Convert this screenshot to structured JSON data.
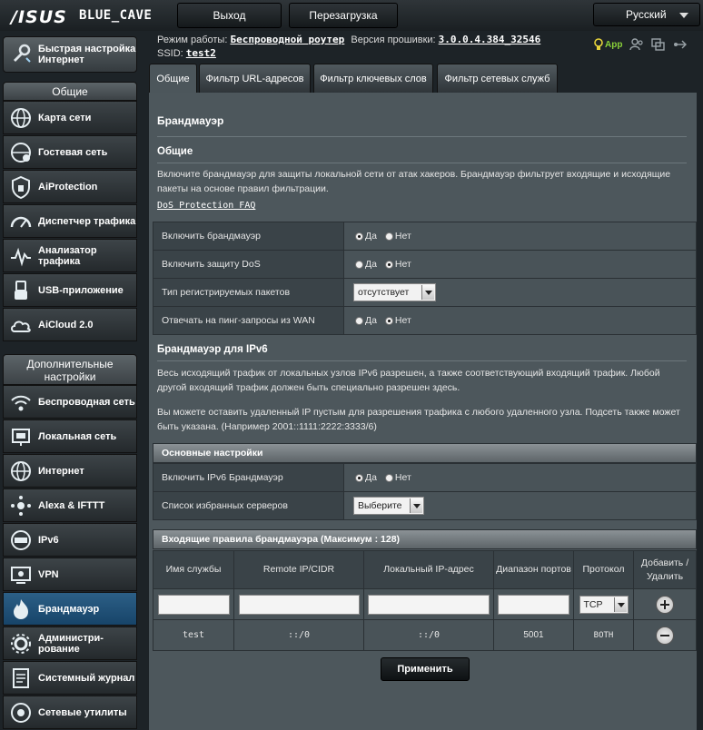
{
  "brand": {
    "logo": "/ISUS",
    "model": "BLUE_CAVE"
  },
  "topbar": {
    "logout": "Выход",
    "reboot": "Перезагрузка",
    "language": "Русский"
  },
  "sidebar": {
    "quick_setup": "Быстрая настройка Интернет",
    "general_header": "Общие",
    "general_items": [
      {
        "label": "Карта сети",
        "icon": "network-map-icon"
      },
      {
        "label": "Гостевая сеть",
        "icon": "guest-network-icon"
      },
      {
        "label": "AiProtection",
        "icon": "aiprotection-icon"
      },
      {
        "label": "Диспетчер трафика",
        "icon": "traffic-manager-icon"
      },
      {
        "label": "Анализатор трафика",
        "icon": "traffic-analyzer-icon"
      },
      {
        "label": "USB-приложение",
        "icon": "usb-icon"
      },
      {
        "label": "AiCloud 2.0",
        "icon": "aicloud-icon"
      }
    ],
    "advanced_header": "Дополнительные настройки",
    "advanced_items": [
      {
        "label": "Беспроводная сеть",
        "icon": "wireless-icon"
      },
      {
        "label": "Локальная сеть",
        "icon": "lan-icon"
      },
      {
        "label": "Интернет",
        "icon": "internet-globe-icon"
      },
      {
        "label": "Alexa & IFTTT",
        "icon": "alexa-icon"
      },
      {
        "label": "IPv6",
        "icon": "ipv6-icon"
      },
      {
        "label": "VPN",
        "icon": "vpn-icon"
      },
      {
        "label": "Брандмауэр",
        "icon": "firewall-icon",
        "active": true
      },
      {
        "label": "Администри-рование",
        "icon": "administration-icon"
      },
      {
        "label": "Системный журнал",
        "icon": "system-log-icon"
      },
      {
        "label": "Сетевые утилиты",
        "icon": "network-tools-icon"
      }
    ]
  },
  "status": {
    "mode_label": "Режим работы:",
    "mode_value": "Беспроводной роутер",
    "firmware_label": "Версия прошивки:",
    "firmware_value": "3.0.0.4.384_32546",
    "ssid_label": "SSID:",
    "ssid_value": "test2",
    "app_label": "App"
  },
  "tabs": [
    "Общие",
    "Фильтр URL-адресов",
    "Фильтр ключевых слов",
    "Фильтр сетевых служб"
  ],
  "page": {
    "title": "Брандмауэр",
    "general_heading": "Общие",
    "general_desc": "Включите брандмауэр для защиты локальной сети от атак хакеров. Брандмауэр фильтрует входящие и исходящие пакеты на основе правил фильтрации.",
    "dos_link": "DoS Protection FAQ",
    "rows": [
      {
        "label": "Включить брандмауэр",
        "yes": "Да",
        "no": "Нет",
        "selected": "yes"
      },
      {
        "label": "Включить защиту DoS",
        "yes": "Да",
        "no": "Нет",
        "selected": "no"
      },
      {
        "label": "Тип регистрируемых пакетов",
        "select": "отсутствует"
      },
      {
        "label": "Отвечать на пинг-запросы из WAN",
        "yes": "Да",
        "no": "Нет",
        "selected": "no"
      }
    ],
    "ipv6_heading": "Брандмауэр для IPv6",
    "ipv6_desc1": "Весь исходящий трафик от локальных узлов IPv6 разрешен, а также соответствующий входящий трафик. Любой другой входящий трафик должен быть специально разрешен здесь.",
    "ipv6_desc2": "Вы можете оставить удаленный IP пустым для разрешения трафика с любого удаленного узла. Подсеть также может быть указана. (Например 2001::1111:2222:3333/6)",
    "basic_header": "Основные настройки",
    "ipv6_rows": [
      {
        "label": "Включить IPv6 Брандмауэр",
        "yes": "Да",
        "no": "Нет",
        "selected": "yes"
      },
      {
        "label": "Список избранных серверов",
        "select": "Выберите"
      }
    ],
    "rules_header": "Входящие правила брандмауэра (Максимум : 128)",
    "rules_columns": [
      "Имя службы",
      "Remote IP/CIDR",
      "Локальный IP-адрес",
      "Диапазон портов",
      "Протокол",
      "Добавить / Удалить"
    ],
    "new_rule_protocol": "TCP",
    "rules": [
      {
        "name": "test",
        "remote": "::/0",
        "local": "::/0",
        "ports": "5001",
        "protocol": "BOTH"
      }
    ],
    "apply": "Применить"
  }
}
